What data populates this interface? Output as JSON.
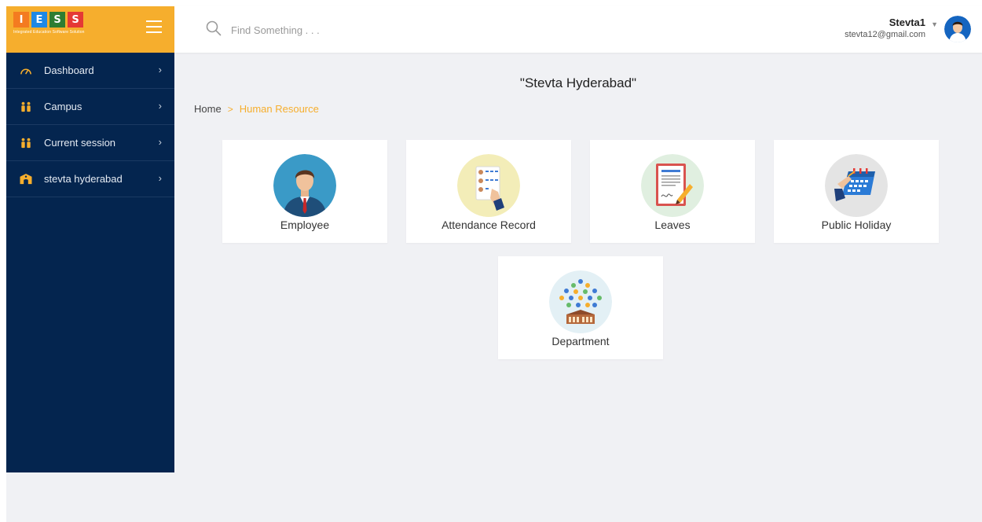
{
  "brand": {
    "letters": [
      "I",
      "E",
      "S",
      "S"
    ],
    "tagline": "Integrated Education Software Solution"
  },
  "search": {
    "placeholder": "Find Something . . ."
  },
  "user": {
    "name": "Stevta1",
    "email": "stevta12@gmail.com"
  },
  "sidebar": {
    "items": [
      {
        "label": "Dashboard",
        "icon": "gauge-icon"
      },
      {
        "label": "Campus",
        "icon": "people-icon"
      },
      {
        "label": "Current session",
        "icon": "people-icon"
      },
      {
        "label": "stevta hyderabad",
        "icon": "school-building-icon"
      }
    ]
  },
  "main": {
    "title": "\"Stevta Hyderabad\"",
    "breadcrumb": {
      "home": "Home",
      "separator": ">",
      "current": "Human Resource"
    },
    "cards": [
      {
        "label": "Employee",
        "icon": "employee-icon"
      },
      {
        "label": "Attendance Record",
        "icon": "attendance-record-icon"
      },
      {
        "label": "Leaves",
        "icon": "leave-document-icon"
      },
      {
        "label": "Public Holiday",
        "icon": "calendar-icon"
      },
      {
        "label": "Department",
        "icon": "department-icon"
      }
    ]
  },
  "colors": {
    "accent": "#f6ae2d",
    "sidebar": "#04254f",
    "background": "#f0f1f4"
  }
}
